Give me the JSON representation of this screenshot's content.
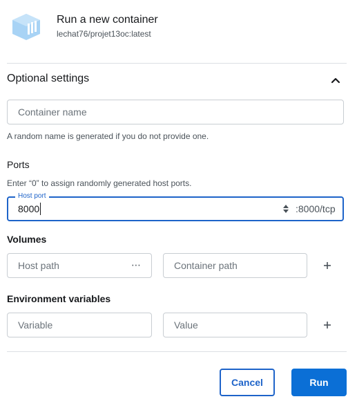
{
  "header": {
    "icon": "container-image-icon",
    "title": "Run a new container",
    "image_name": "lechat76/projet13oc:latest"
  },
  "optional_settings": {
    "title": "Optional settings",
    "toggle_icon": "chevron-up-icon",
    "container_name_placeholder": "Container name",
    "container_name_help": "A random name is generated if you do not provide one."
  },
  "ports": {
    "title": "Ports",
    "help": "Enter “0” to assign randomly generated host ports.",
    "host_port_label": "Host port",
    "host_port_value": "8000",
    "container_port_suffix": ":8000/tcp"
  },
  "volumes": {
    "title": "Volumes",
    "host_path_placeholder": "Host path",
    "host_path_browse": "⋯",
    "container_path_placeholder": "Container path",
    "add_icon": "plus-icon"
  },
  "env": {
    "title": "Environment variables",
    "variable_placeholder": "Variable",
    "value_placeholder": "Value",
    "add_icon": "plus-icon"
  },
  "actions": {
    "cancel_label": "Cancel",
    "run_label": "Run"
  },
  "colors": {
    "accent": "#1d63c9",
    "run_button": "#0b6fd6",
    "icon_light": "#a8d3f5"
  }
}
